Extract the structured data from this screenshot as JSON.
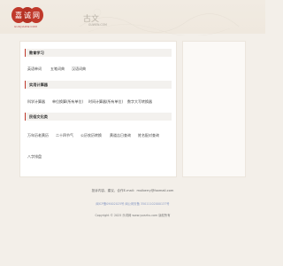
{
  "header": {
    "logo_text": "嘉诚网",
    "logo_sub": "GUOJIAOW.COM",
    "brand_zh": "古文",
    "brand_url": "GUWEN.COM"
  },
  "sections": [
    {
      "title": "教育学习",
      "items": [
        "英语单词",
        "五笔词典",
        "汉语词典"
      ]
    },
    {
      "title": "实用计算器",
      "items": [
        "科学计算器",
        "单位换算(所有单位)",
        "时间计算器(所有单位)",
        "数字大写转换器"
      ]
    },
    {
      "title": "民俗文化类",
      "items": [
        "万年历老黄历",
        "二十四节气",
        "公历农历转换",
        "黄道吉日查询",
        "姓名配对查询",
        "八字排盘"
      ]
    }
  ],
  "footer": {
    "contact": "投诉内容、建议、合作E-mail：mulberry@foxmail.com",
    "icp": "闽ICP备09002025号  闽公网安备 35011102000137号",
    "copyright": "Copyright © 2025 乐词网 www.yuezhu.com 版权所有"
  },
  "colors": {
    "accent": "#c0392b",
    "page_bg": "#f3efe9",
    "card_bg": "#ffffff"
  }
}
